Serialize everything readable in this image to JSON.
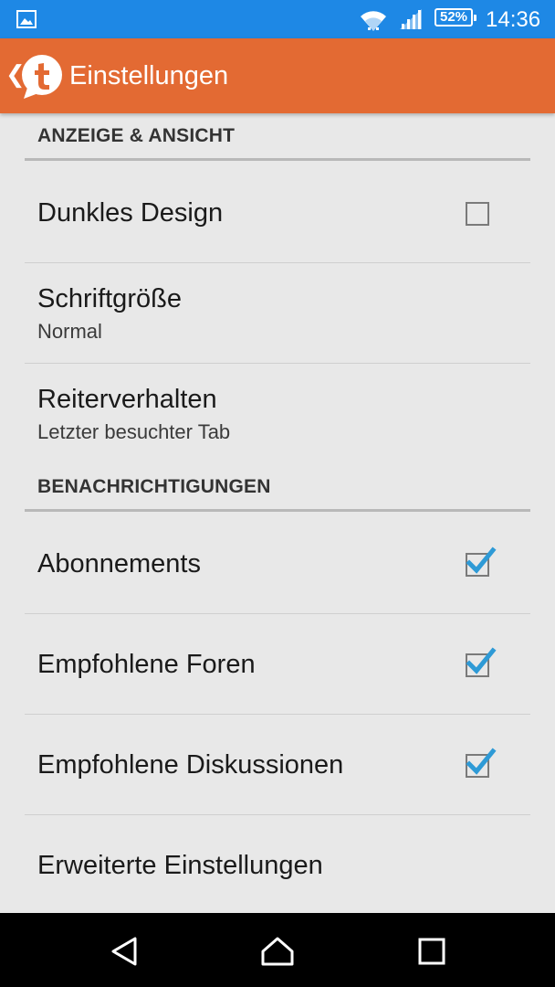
{
  "status_bar": {
    "time": "14:36",
    "battery": "52%",
    "icons": [
      "gallery-icon",
      "wifi-icon",
      "signal-icon",
      "battery-icon"
    ]
  },
  "action_bar": {
    "title": "Einstellungen",
    "logo_icon": "t-logo-icon",
    "accent_color": "#e36a33"
  },
  "sections": [
    {
      "header": "ANZEIGE & ANSICHT",
      "items": [
        {
          "title": "Dunkles Design",
          "checked": false
        },
        {
          "title": "Schriftgröße",
          "summary": "Normal"
        },
        {
          "title": "Reiterverhalten",
          "summary": "Letzter besuchter Tab"
        }
      ]
    },
    {
      "header": "BENACHRICHTIGUNGEN",
      "items": [
        {
          "title": "Abonnements",
          "checked": true
        },
        {
          "title": "Empfohlene Foren",
          "checked": true
        },
        {
          "title": "Empfohlene Diskussionen",
          "checked": true
        },
        {
          "title": "Erweiterte Einstellungen"
        }
      ]
    }
  ],
  "nav_bar": {
    "buttons": [
      "back-icon",
      "home-icon",
      "recent-apps-icon"
    ]
  },
  "colors": {
    "status_bar": "#1e88e5",
    "check_blue": "#2e9ad6",
    "background": "#e8e8e8"
  }
}
